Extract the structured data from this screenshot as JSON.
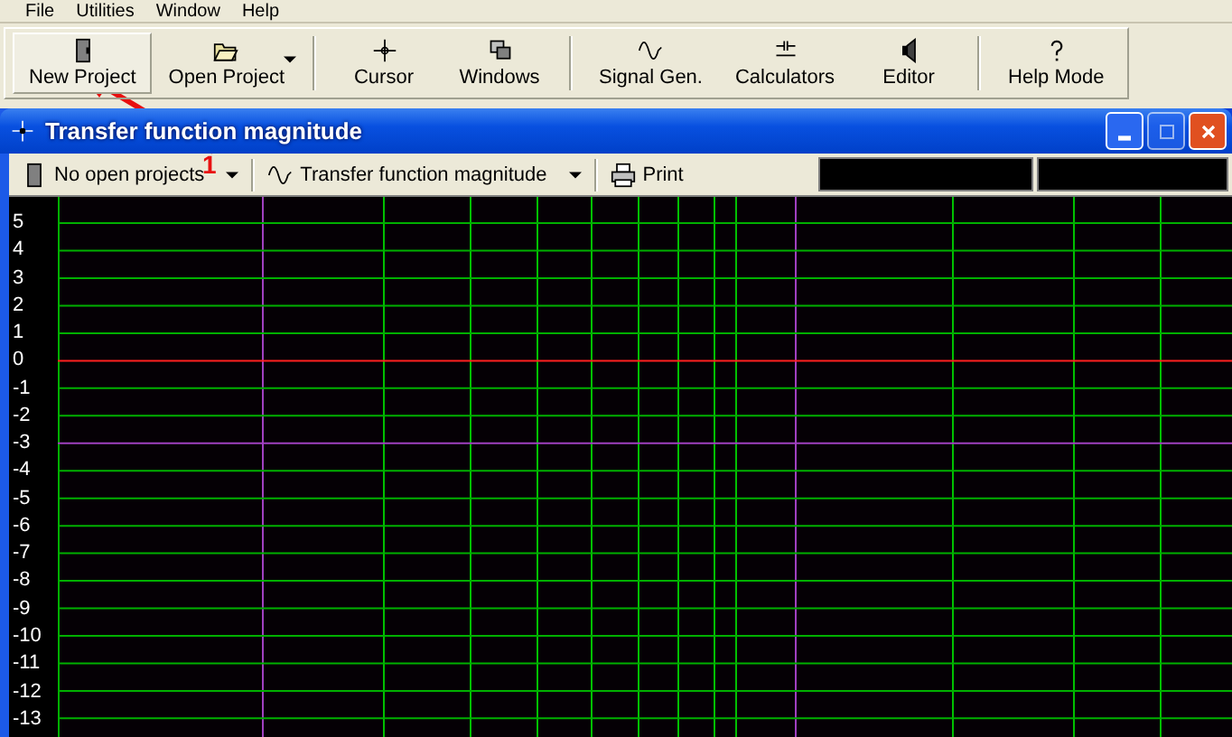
{
  "menu": [
    "File",
    "Utilities",
    "Window",
    "Help"
  ],
  "toolbar": [
    {
      "label": "New Project",
      "dropdown": false,
      "pressed": true
    },
    {
      "label": "Open Project",
      "dropdown": true,
      "pressed": false
    },
    {
      "label": "Cursor",
      "dropdown": false,
      "pressed": false
    },
    {
      "label": "Windows",
      "dropdown": false,
      "pressed": false
    },
    {
      "label": "Signal Gen.",
      "dropdown": false,
      "pressed": false
    },
    {
      "label": "Calculators",
      "dropdown": false,
      "pressed": false
    },
    {
      "label": "Editor",
      "dropdown": false,
      "pressed": false
    },
    {
      "label": "Help Mode",
      "dropdown": false,
      "pressed": false
    }
  ],
  "window": {
    "title": "Transfer function magnitude"
  },
  "window_toolbar": {
    "project": "No open projects",
    "view": "Transfer function magnitude",
    "print": "Print"
  },
  "y_labels": [
    {
      "text": "5",
      "kind": "normal"
    },
    {
      "text": "4",
      "kind": "normal"
    },
    {
      "text": "3",
      "kind": "normal"
    },
    {
      "text": "2",
      "kind": "normal"
    },
    {
      "text": "1",
      "kind": "normal"
    },
    {
      "text": "0",
      "kind": "zero"
    },
    {
      "text": "-1",
      "kind": "normal"
    },
    {
      "text": "-2",
      "kind": "normal"
    },
    {
      "text": "-3",
      "kind": "marker"
    },
    {
      "text": "-4",
      "kind": "normal"
    },
    {
      "text": "-5",
      "kind": "normal"
    },
    {
      "text": "-6",
      "kind": "normal"
    },
    {
      "text": "-7",
      "kind": "normal"
    },
    {
      "text": "-8",
      "kind": "normal"
    },
    {
      "text": "-9",
      "kind": "normal"
    },
    {
      "text": "-10",
      "kind": "normal"
    },
    {
      "text": "-11",
      "kind": "normal"
    },
    {
      "text": "-12",
      "kind": "normal"
    },
    {
      "text": "-13",
      "kind": "normal"
    }
  ],
  "annotation": {
    "text": "1"
  }
}
